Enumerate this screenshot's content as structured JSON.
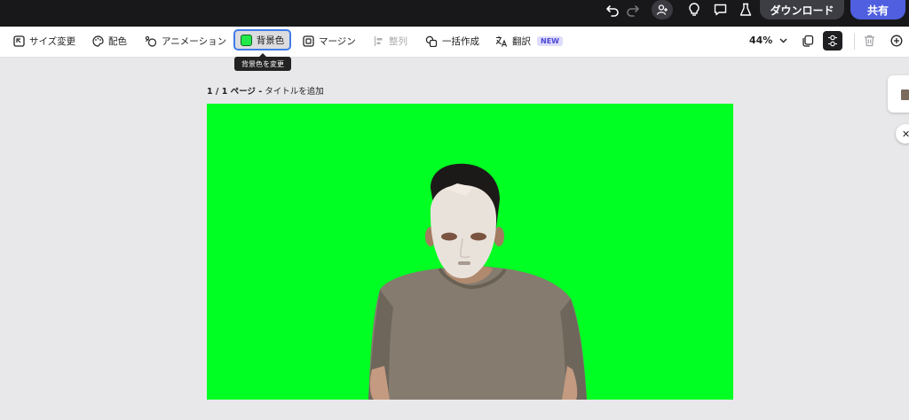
{
  "topbar": {
    "download_label": "ダウンロード",
    "share_label": "共有",
    "share_color": "#4f5fe0"
  },
  "toolbar": {
    "resize_label": "サイズ変更",
    "color_label": "配色",
    "animation_label": "アニメーション",
    "background_label": "背景色",
    "background_swatch_color": "#22e84a",
    "margin_label": "マージン",
    "align_label": "整列",
    "bulk_create_label": "一括作成",
    "translate_label": "翻訳",
    "translate_badge": "NEW",
    "zoom_value": "44%",
    "tooltip": "背景色を変更"
  },
  "page": {
    "counter": "1 / 1 ページ -",
    "title_placeholder": "タイトルを追加",
    "canvas_background": "#00ff22"
  },
  "icons": {
    "undo": "undo-icon",
    "redo": "redo-icon",
    "add_user": "add-user-icon",
    "idea": "lightbulb-icon",
    "comment": "comment-icon",
    "lab": "flask-icon",
    "resize": "resize-icon",
    "palette": "palette-icon",
    "animation": "animation-icon",
    "margin": "margin-icon",
    "align": "align-icon",
    "bulk": "bulk-create-icon",
    "translate": "translate-icon",
    "duplicate": "duplicate-icon",
    "layers": "layers-icon",
    "trash": "trash-icon",
    "add_page": "add-page-icon",
    "close": "close-icon"
  }
}
